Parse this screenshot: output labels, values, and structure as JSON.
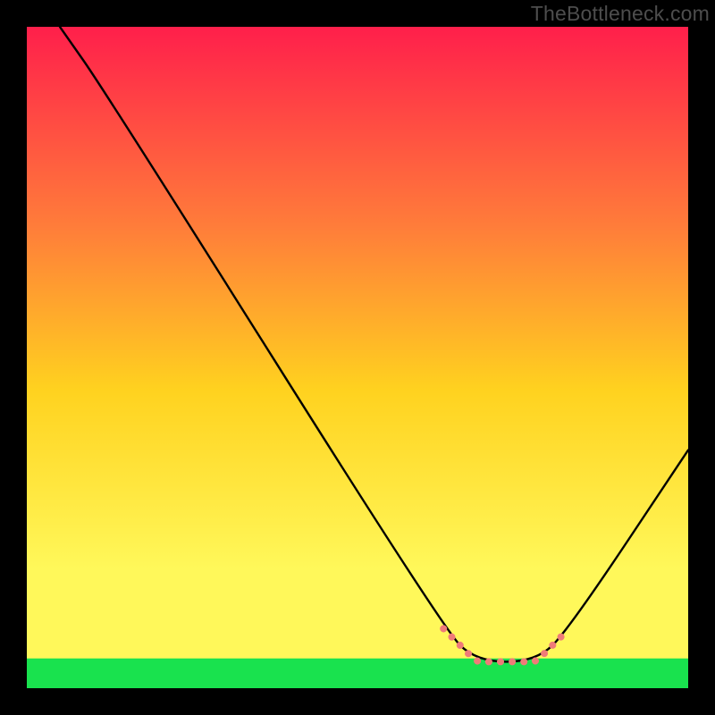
{
  "watermark": "TheBottleneck.com",
  "chart_data": {
    "type": "line",
    "title": "",
    "xlabel": "",
    "ylabel": "",
    "xlim": [
      0,
      100
    ],
    "ylim": [
      0,
      100
    ],
    "series": [
      {
        "name": "curve",
        "x": [
          5,
          12,
          63,
          68,
          77,
          82,
          100
        ],
        "y": [
          100,
          90,
          9,
          4,
          4,
          9,
          36
        ]
      }
    ],
    "highlight_zone": {
      "x_start": 63,
      "x_end": 82
    },
    "green_band_y": [
      0,
      4.5
    ],
    "background_gradient": {
      "top": "#ff1f4b",
      "upper_mid": "#ff7c3a",
      "mid": "#ffd21f",
      "lower_mid": "#fff85a",
      "bottom": "#19e24e"
    }
  }
}
